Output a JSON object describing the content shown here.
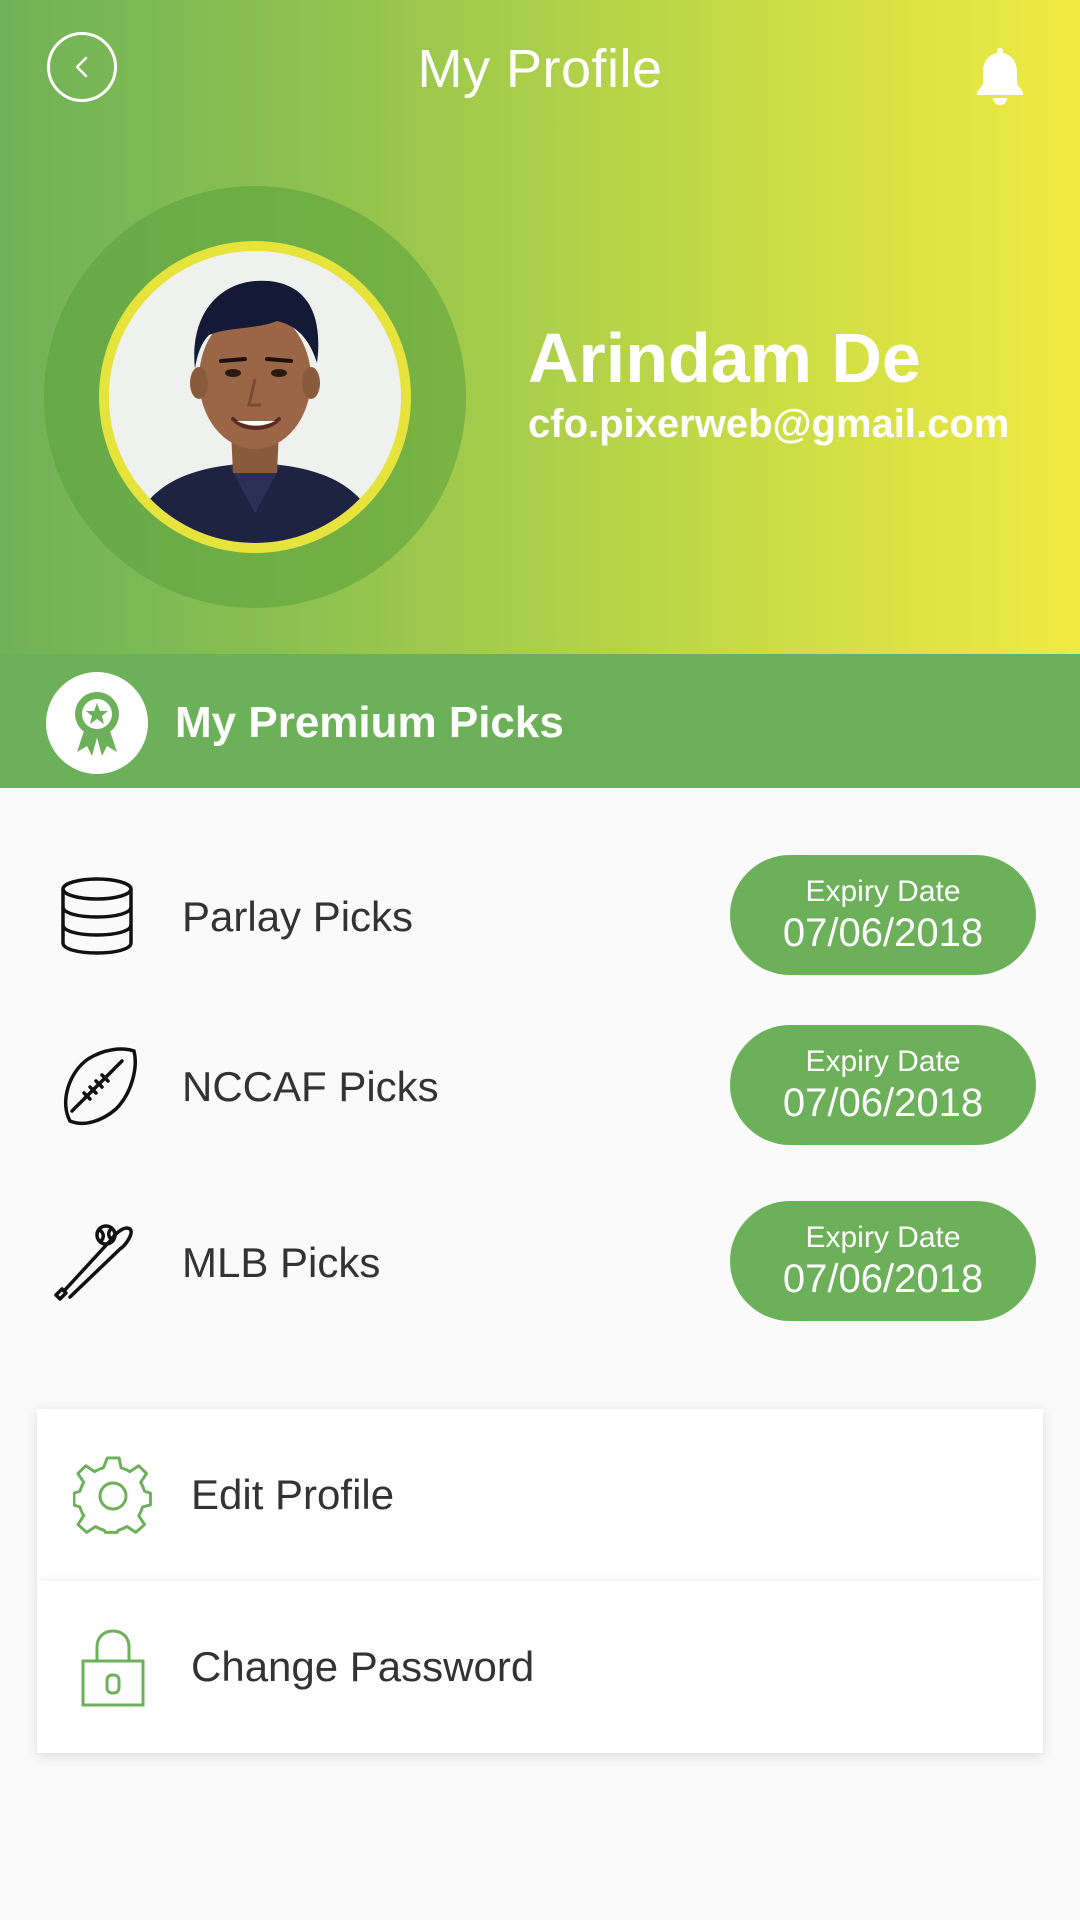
{
  "header": {
    "title": "My Profile",
    "back_icon": "chevron-left-icon",
    "notification_icon": "bell-icon"
  },
  "profile": {
    "name": "Arindam De",
    "email": "cfo.pixerweb@gmail.com"
  },
  "premium": {
    "title": "My Premium Picks",
    "icon": "award-ribbon-icon",
    "picks": [
      {
        "label": "Parlay Picks",
        "icon": "database-stack-icon",
        "expiry_caption": "Expiry Date",
        "expiry_date": "07/06/2018"
      },
      {
        "label": "NCCAF Picks",
        "icon": "football-icon",
        "expiry_caption": "Expiry Date",
        "expiry_date": "07/06/2018"
      },
      {
        "label": "MLB Picks",
        "icon": "baseball-bat-icon",
        "expiry_caption": "Expiry Date",
        "expiry_date": "07/06/2018"
      }
    ]
  },
  "menu": {
    "edit_profile": "Edit Profile",
    "change_password": "Change Password"
  },
  "colors": {
    "brand_green": "#6db05a",
    "gradient_start": "#6fb258",
    "gradient_end": "#f1ea42",
    "ring_yellow": "#e6e43c"
  }
}
